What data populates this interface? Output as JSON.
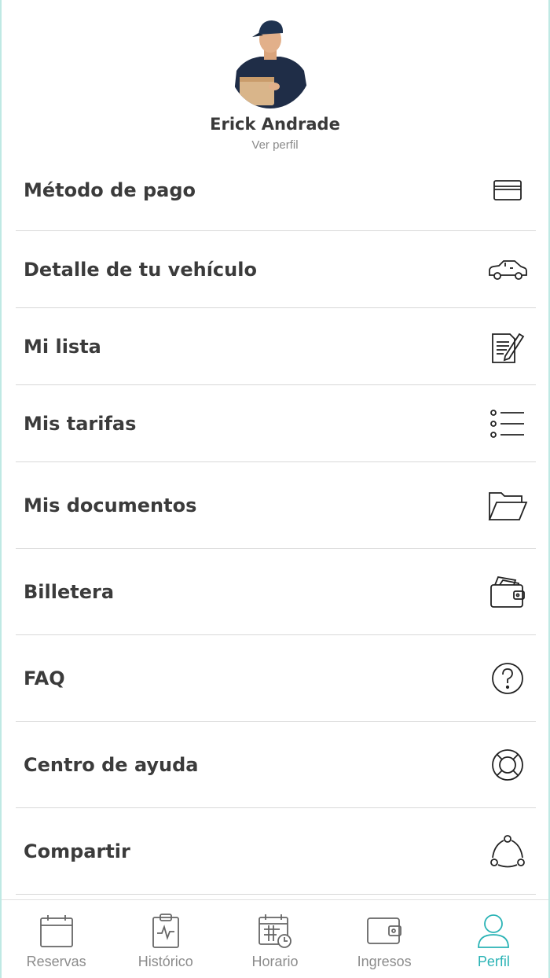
{
  "profile": {
    "name": "Erick Andrade",
    "view_profile": "Ver perfil"
  },
  "menu": {
    "items": [
      {
        "label": "Método de pago",
        "icon": "credit-card-icon"
      },
      {
        "label": "Detalle de tu vehículo",
        "icon": "car-icon"
      },
      {
        "label": "Mi lista",
        "icon": "document-edit-icon"
      },
      {
        "label": "Mis tarifas",
        "icon": "list-icon"
      },
      {
        "label": "Mis documentos",
        "icon": "folder-icon"
      },
      {
        "label": "Billetera",
        "icon": "wallet-icon"
      },
      {
        "label": "FAQ",
        "icon": "question-icon"
      },
      {
        "label": "Centro de ayuda",
        "icon": "lifebuoy-icon"
      },
      {
        "label": "Compartir",
        "icon": "share-icon"
      }
    ]
  },
  "bottom_nav": {
    "items": [
      {
        "label": "Reservas",
        "icon": "calendar-icon"
      },
      {
        "label": "Histórico",
        "icon": "clipboard-chart-icon"
      },
      {
        "label": "Horario",
        "icon": "schedule-icon"
      },
      {
        "label": "Ingresos",
        "icon": "wallet-icon"
      },
      {
        "label": "Perfil",
        "icon": "user-icon"
      }
    ],
    "active": "Perfil",
    "active_color": "#2ab3b5",
    "inactive_color": "#8c8c8c"
  }
}
